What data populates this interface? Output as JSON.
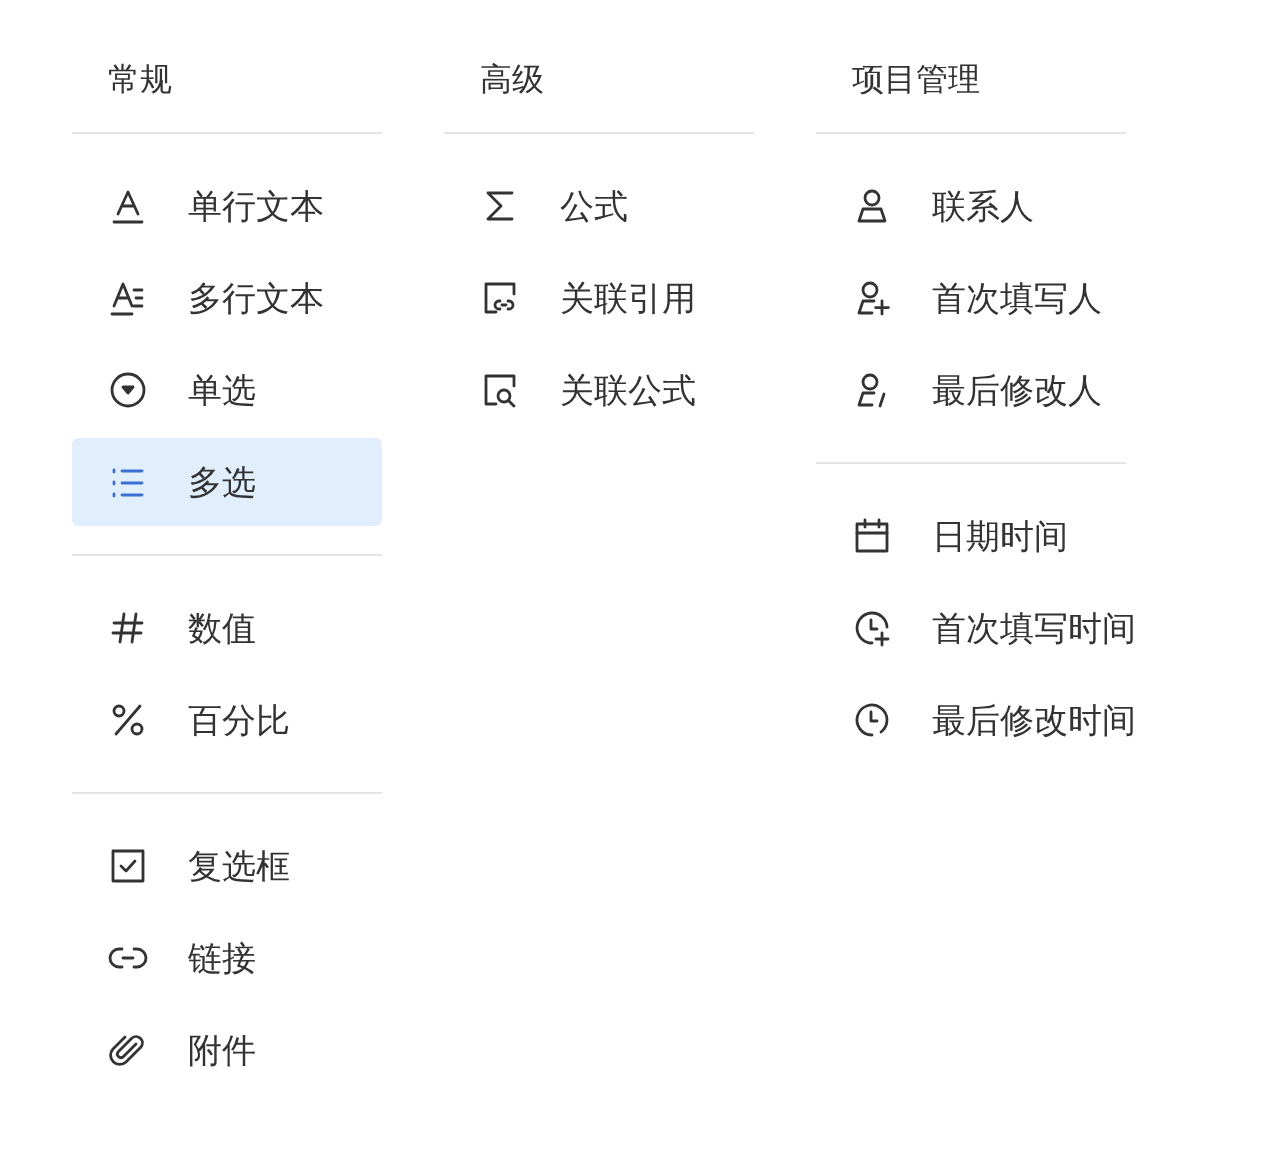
{
  "columns": [
    {
      "title": "常规",
      "groups": [
        {
          "items": [
            {
              "label": "单行文本",
              "kind": "text",
              "selected": false
            },
            {
              "label": "多行文本",
              "kind": "multitext",
              "selected": false
            },
            {
              "label": "单选",
              "kind": "radio",
              "selected": false
            },
            {
              "label": "多选",
              "kind": "list",
              "selected": true
            }
          ]
        },
        {
          "items": [
            {
              "label": "数值",
              "kind": "hash",
              "selected": false
            },
            {
              "label": "百分比",
              "kind": "percent",
              "selected": false
            }
          ]
        },
        {
          "items": [
            {
              "label": "复选框",
              "kind": "checkbox",
              "selected": false
            },
            {
              "label": "链接",
              "kind": "link",
              "selected": false
            },
            {
              "label": "附件",
              "kind": "clip",
              "selected": false
            }
          ]
        }
      ]
    },
    {
      "title": "高级",
      "groups": [
        {
          "items": [
            {
              "label": "公式",
              "kind": "sigma",
              "selected": false
            },
            {
              "label": "关联引用",
              "kind": "reflink",
              "selected": false
            },
            {
              "label": "关联公式",
              "kind": "refsearch",
              "selected": false
            }
          ]
        }
      ]
    },
    {
      "title": "项目管理",
      "groups": [
        {
          "items": [
            {
              "label": "联系人",
              "kind": "person",
              "selected": false
            },
            {
              "label": "首次填写人",
              "kind": "personplus",
              "selected": false
            },
            {
              "label": "最后修改人",
              "kind": "personedit",
              "selected": false
            }
          ]
        },
        {
          "items": [
            {
              "label": "日期时间",
              "kind": "calendar",
              "selected": false
            },
            {
              "label": "首次填写时间",
              "kind": "clockplus",
              "selected": false
            },
            {
              "label": "最后修改时间",
              "kind": "clock",
              "selected": false
            }
          ]
        }
      ]
    }
  ]
}
